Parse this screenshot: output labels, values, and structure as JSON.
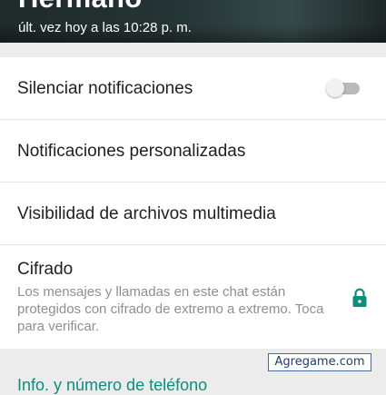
{
  "contact": {
    "name": "Hermano",
    "last_seen": "últ. vez hoy a las 10:28 p. m."
  },
  "settings": {
    "mute_label": "Silenciar notificaciones",
    "mute_enabled": false,
    "custom_notifications_label": "Notificaciones personalizadas",
    "media_visibility_label": "Visibilidad de archivos multimedia",
    "encryption_label": "Cifrado",
    "encryption_description": "Los mensajes y llamadas en este chat están protegidos con cifrado de extremo a extremo. Toca para verificar."
  },
  "next_section": {
    "label": "Info. y número de teléfono"
  },
  "watermark": "Agregame.com",
  "icons": {
    "toggle": "toggle-switch",
    "lock": "lock-icon"
  },
  "colors": {
    "accent": "#0a8f7c",
    "toggle_track_off": "#b9b9b9",
    "secondary_text": "#8f8f8f"
  }
}
